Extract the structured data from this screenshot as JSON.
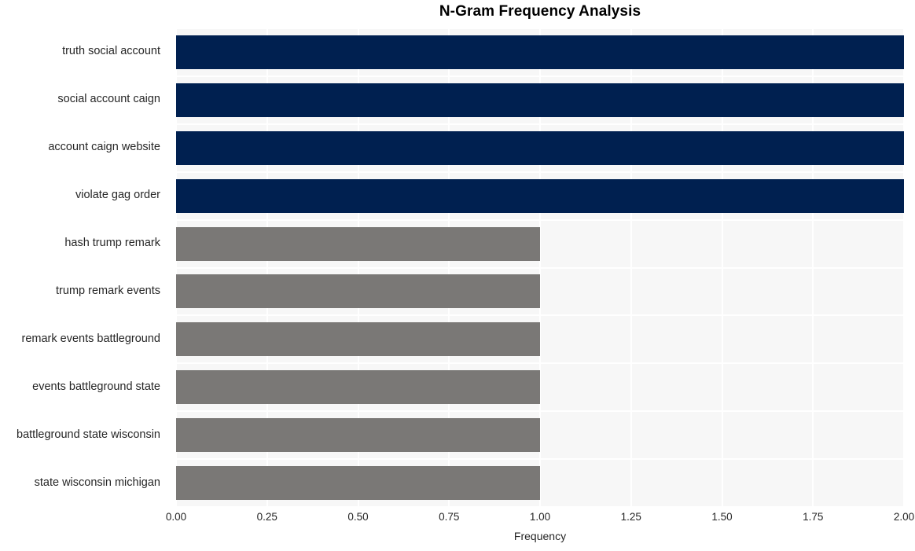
{
  "chart_data": {
    "type": "bar",
    "orientation": "horizontal",
    "title": "N-Gram Frequency Analysis",
    "xlabel": "Frequency",
    "ylabel": "",
    "categories": [
      "truth social account",
      "social account caign",
      "account caign website",
      "violate gag order",
      "hash trump remark",
      "trump remark events",
      "remark events battleground",
      "events battleground state",
      "battleground state wisconsin",
      "state wisconsin michigan"
    ],
    "values": [
      2,
      2,
      2,
      2,
      1,
      1,
      1,
      1,
      1,
      1
    ],
    "xlim": [
      0.0,
      2.0
    ],
    "xticks": [
      0.0,
      0.25,
      0.5,
      0.75,
      1.0,
      1.25,
      1.5,
      1.75,
      2.0
    ],
    "xtick_labels": [
      "0.00",
      "0.25",
      "0.50",
      "0.75",
      "1.00",
      "1.25",
      "1.50",
      "1.75",
      "2.00"
    ],
    "bar_colors": [
      "#002050",
      "#002050",
      "#002050",
      "#002050",
      "#7a7876",
      "#7a7876",
      "#7a7876",
      "#7a7876",
      "#7a7876",
      "#7a7876"
    ],
    "grid": true,
    "grid_color": "#ffffff",
    "plot_background": "#f7f7f7",
    "figure_background": "#ffffff",
    "legend": null
  }
}
